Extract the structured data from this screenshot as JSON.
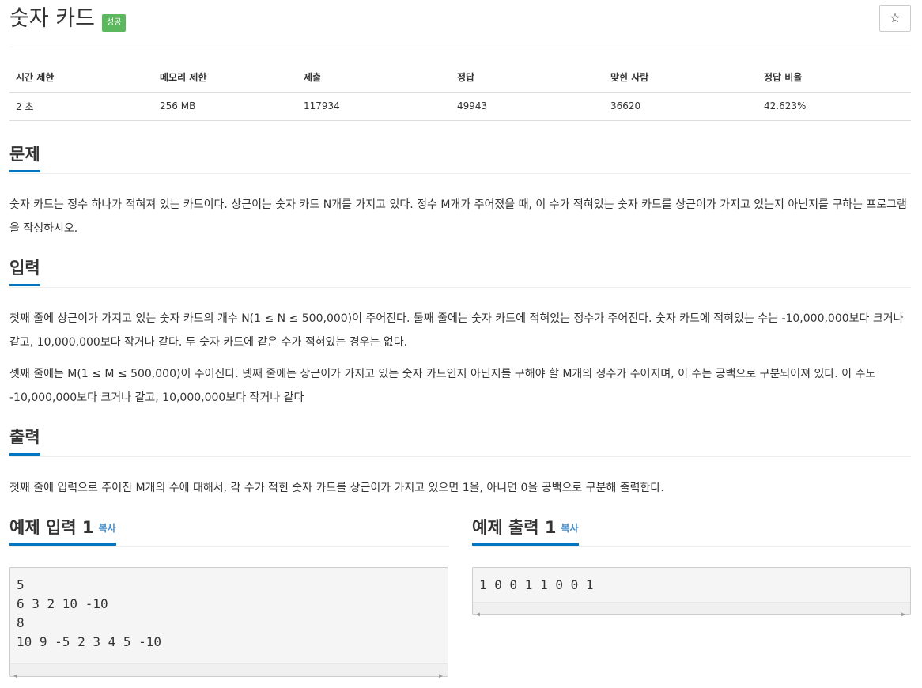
{
  "problem": {
    "title": "숫자 카드",
    "status_badge": "성공",
    "star_icon": "☆"
  },
  "info_table": {
    "headers": [
      "시간 제한",
      "메모리 제한",
      "제출",
      "정답",
      "맞힌 사람",
      "정답 비율"
    ],
    "values": [
      "2 초",
      "256 MB",
      "117934",
      "49943",
      "36620",
      "42.623%"
    ]
  },
  "sections": {
    "problem": {
      "heading": "문제",
      "text": "숫자 카드는 정수 하나가 적혀져 있는 카드이다. 상근이는 숫자 카드 N개를 가지고 있다. 정수 M개가 주어졌을 때, 이 수가 적혀있는 숫자 카드를 상근이가 가지고 있는지 아닌지를 구하는 프로그램을 작성하시오."
    },
    "input": {
      "heading": "입력",
      "text1": "첫째 줄에 상근이가 가지고 있는 숫자 카드의 개수 N(1 ≤ N ≤ 500,000)이 주어진다. 둘째 줄에는 숫자 카드에 적혀있는 정수가 주어진다. 숫자 카드에 적혀있는 수는 -10,000,000보다 크거나 같고, 10,000,000보다 작거나 같다. 두 숫자 카드에 같은 수가 적혀있는 경우는 없다.",
      "text2": "셋째 줄에는 M(1 ≤ M ≤ 500,000)이 주어진다. 넷째 줄에는 상근이가 가지고 있는 숫자 카드인지 아닌지를 구해야 할 M개의 정수가 주어지며, 이 수는 공백으로 구분되어져 있다. 이 수도 -10,000,000보다 크거나 같고, 10,000,000보다 작거나 같다"
    },
    "output": {
      "heading": "출력",
      "text": "첫째 줄에 입력으로 주어진 M개의 수에 대해서, 각 수가 적힌 숫자 카드를 상근이가 가지고 있으면 1을, 아니면 0을 공백으로 구분해 출력한다."
    },
    "sample_input": {
      "heading": "예제 입력 1",
      "copy_label": "복사",
      "content": "5\n6 3 2 10 -10\n8\n10 9 -5 2 3 4 5 -10"
    },
    "sample_output": {
      "heading": "예제 출력 1",
      "copy_label": "복사",
      "content": "1 0 0 1 1 0 0 1"
    }
  },
  "icons": {
    "scroll_left": "◀",
    "scroll_right": "▶"
  }
}
